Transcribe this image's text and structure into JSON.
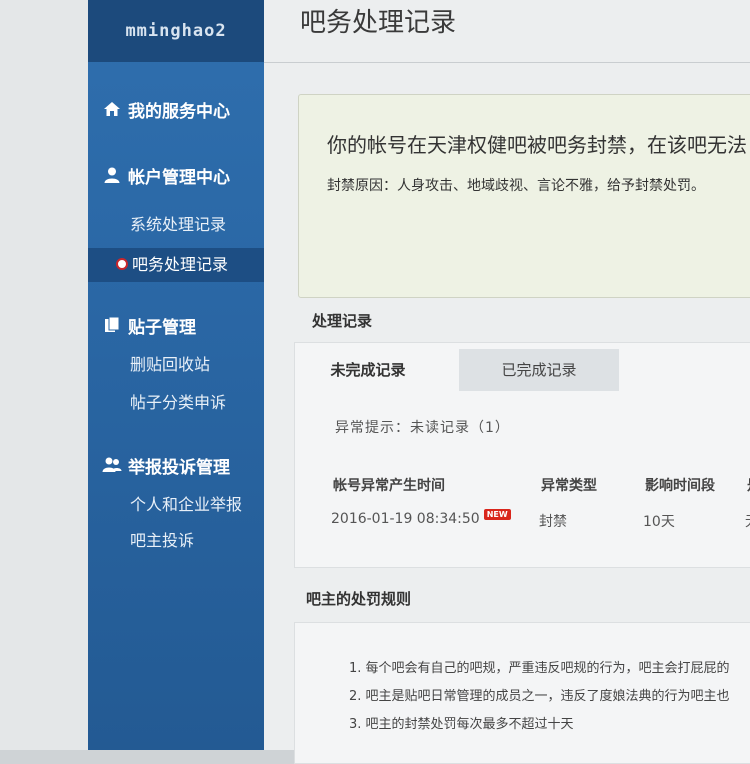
{
  "sidebar": {
    "username": "mminghao2",
    "sections": [
      {
        "title": "我的服务中心",
        "icon": "home-icon",
        "items": []
      },
      {
        "title": "帐户管理中心",
        "icon": "user-icon",
        "items": [
          "系统处理记录",
          "吧务处理记录"
        ]
      },
      {
        "title": "贴子管理",
        "icon": "document-icon",
        "items": [
          "删贴回收站",
          "帖子分类申诉"
        ]
      },
      {
        "title": "举报投诉管理",
        "icon": "users-icon",
        "items": [
          "个人和企业举报",
          "吧主投诉"
        ]
      }
    ],
    "active_item": "吧务处理记录"
  },
  "page": {
    "title": "吧务处理记录"
  },
  "notice": {
    "main": "你的帐号在天津权健吧被吧务封禁，在该吧无法",
    "reason": "封禁原因：人身攻击、地域歧视、言论不雅，给予封禁处罚。"
  },
  "records": {
    "title": "处理记录",
    "tabs": [
      "未完成记录",
      "已完成记录"
    ],
    "hint": "异常提示：未读记录（1）",
    "columns": [
      "帐号异常产生时间",
      "异常类型",
      "影响时间段",
      "是"
    ],
    "rows": [
      {
        "time": "2016-01-19 08:34:50",
        "badge": "NEW",
        "type": "封禁",
        "duration": "10天",
        "extra": "无"
      }
    ]
  },
  "rules": {
    "title": "吧主的处罚规则",
    "items": [
      "1. 每个吧会有自己的吧规，严重违反吧规的行为，吧主会打屁屁的",
      "2. 吧主是贴吧日常管理的成员之一，违反了度娘法典的行为吧主也",
      "3. 吧主的封禁处罚每次最多不超过十天"
    ]
  },
  "colors": {
    "sidebar": "#2a67a5",
    "sidebar_dark": "#1c4a7c",
    "badge": "#d9261c"
  }
}
